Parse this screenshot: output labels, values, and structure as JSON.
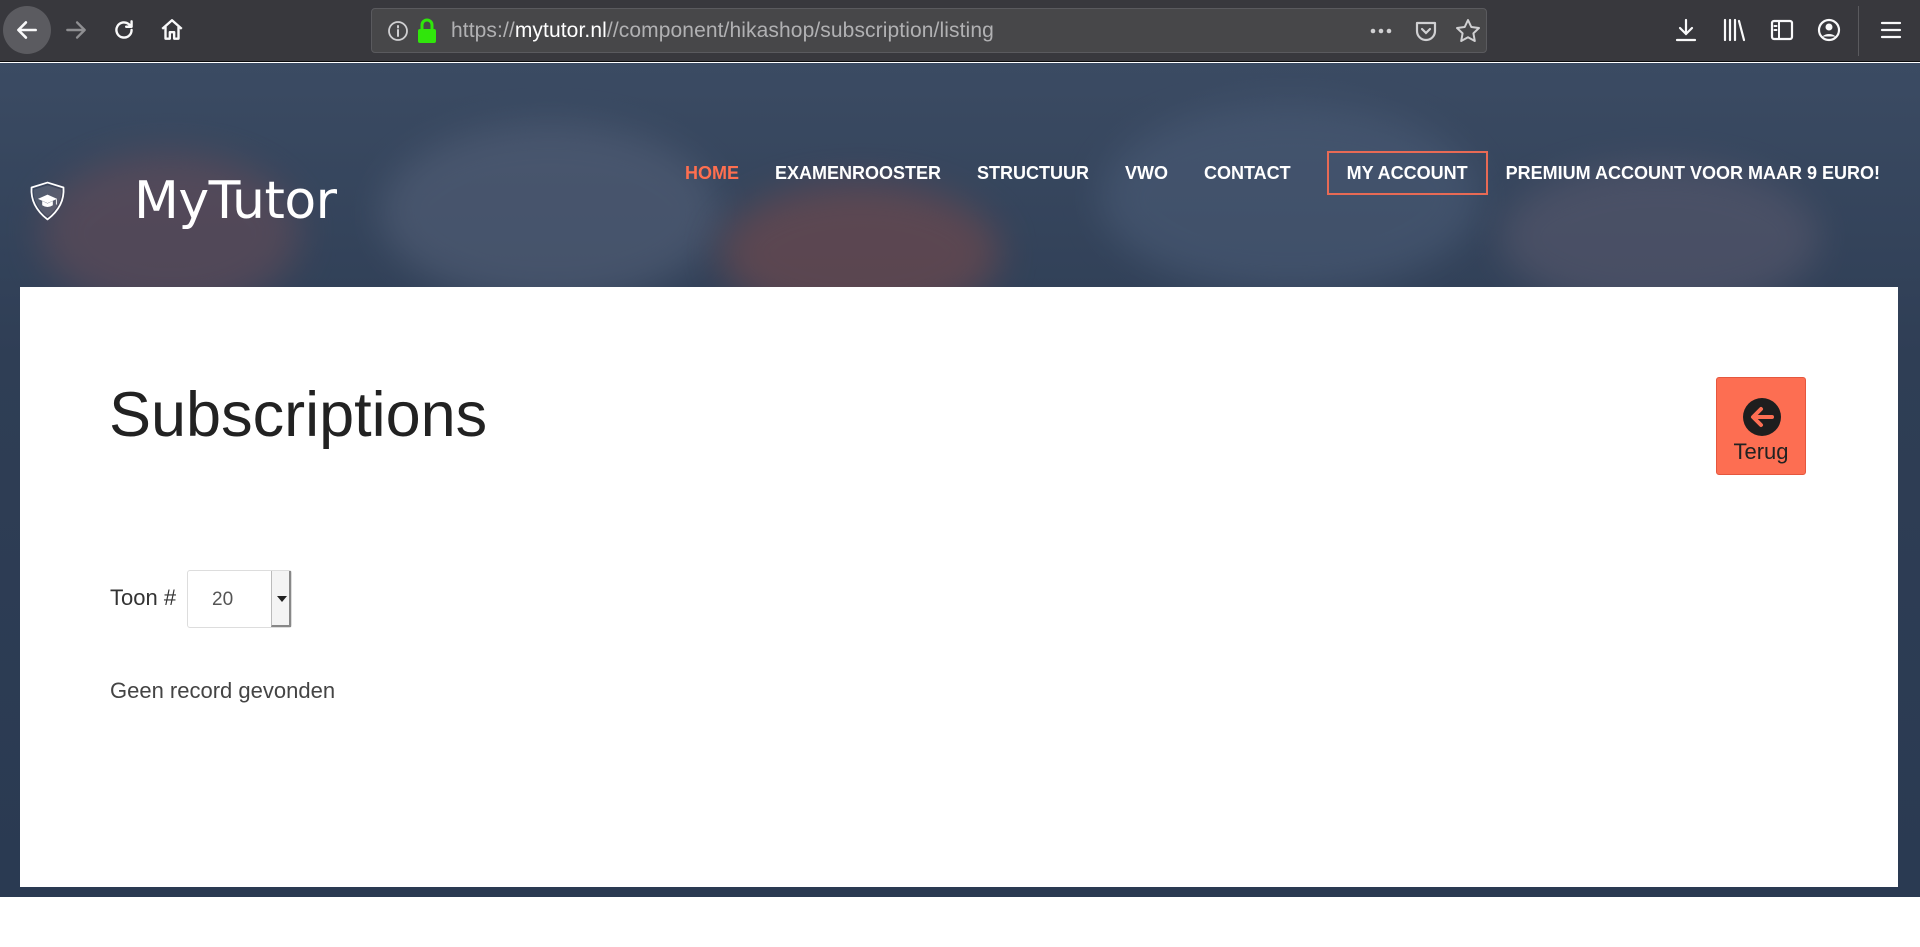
{
  "browser": {
    "url_prefix": "https://",
    "url_domain": "mytutor.nl",
    "url_path": "//component/hikashop/subscription/listing"
  },
  "header": {
    "logo_text": "MyTutor",
    "nav": [
      {
        "label": "HOME",
        "active": true
      },
      {
        "label": "EXAMENROOSTER",
        "active": false
      },
      {
        "label": "STRUCTUUR",
        "active": false
      },
      {
        "label": "VWO",
        "active": false
      },
      {
        "label": "CONTACT",
        "active": false
      },
      {
        "label": "MY ACCOUNT",
        "active": false
      },
      {
        "label": "PREMIUM ACCOUNT VOOR MAAR 9 EURO!",
        "active": false
      }
    ]
  },
  "main": {
    "title": "Subscriptions",
    "back_button_label": "Terug",
    "show_label": "Toon #",
    "page_size_value": "20",
    "empty_message": "Geen record gevonden"
  },
  "colors": {
    "accent": "#fd6e52",
    "header_bg": "#2f3e55",
    "toolbar_bg": "#38383d"
  }
}
